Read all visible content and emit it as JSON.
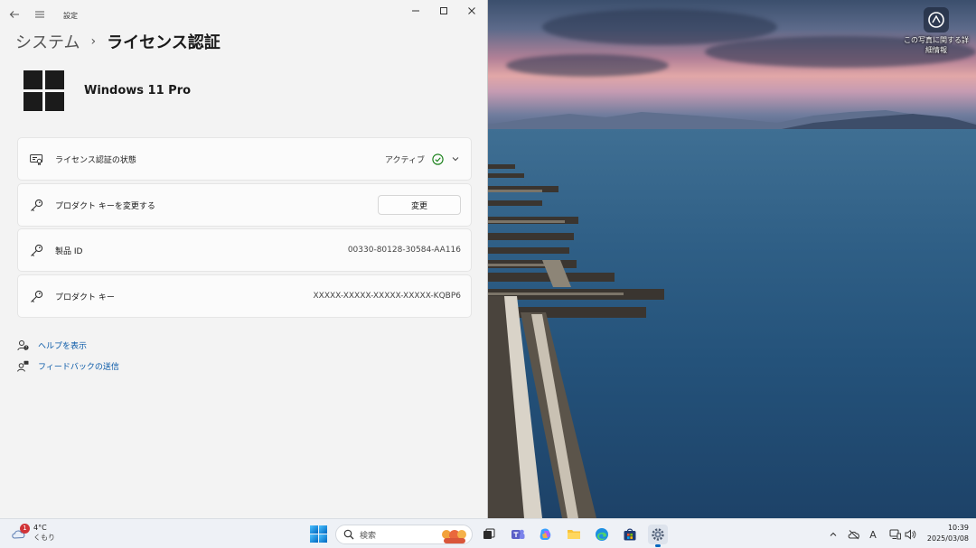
{
  "window": {
    "title": "設定",
    "breadcrumb_parent": "システム",
    "breadcrumb_separator": "›",
    "breadcrumb_current": "ライセンス認証",
    "product_name": "Windows 11 Pro"
  },
  "rows": [
    {
      "label": "ライセンス認証の状態",
      "value": "アクティブ",
      "icon": "certificate-icon"
    },
    {
      "label": "プロダクト キーを変更する",
      "button": "変更",
      "icon": "key-icon"
    },
    {
      "label": "製品 ID",
      "value": "00330-80128-30584-AA116",
      "icon": "key-icon"
    },
    {
      "label": "プロダクト キー",
      "value": "XXXXX-XXXXX-XXXXX-XXXXX-KQBP6",
      "icon": "key-icon"
    }
  ],
  "links": {
    "help": "ヘルプを表示",
    "feedback": "フィードバックの送信"
  },
  "desktop_icon": {
    "label_line1": "この写真に関する詳",
    "label_line2": "細情報"
  },
  "taskbar": {
    "weather_temp": "4°C",
    "weather_desc": "くもり",
    "weather_badge": "1",
    "search_placeholder": "検索",
    "time": "10:39",
    "date": "2025/03/08",
    "ime_indicator": "A"
  },
  "colors": {
    "accent": "#0067c0",
    "link": "#0a5aa8",
    "status_ok": "#0f7b0f"
  }
}
